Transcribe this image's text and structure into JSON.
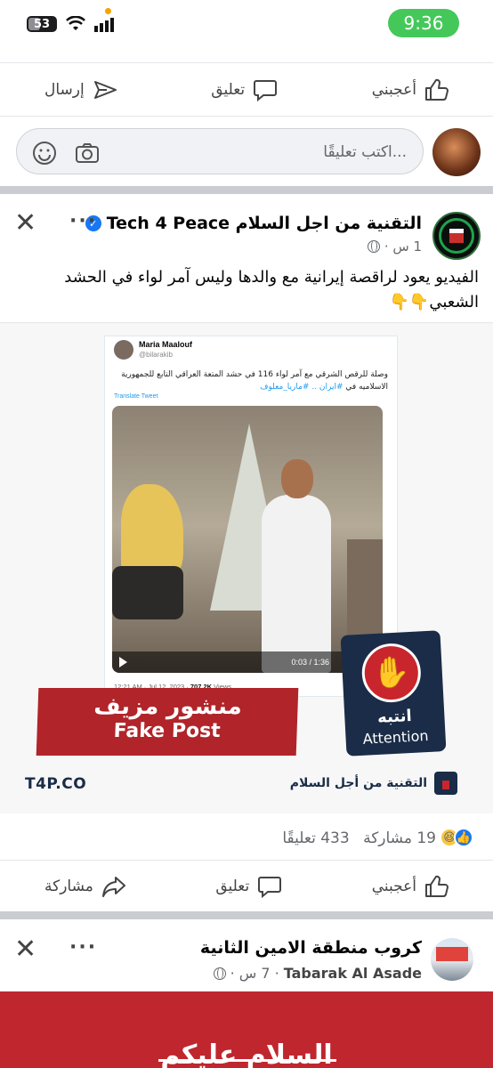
{
  "status_bar": {
    "battery": "53",
    "time": "9:36"
  },
  "top_actions": {
    "like": "أعجبني",
    "comment": "تعليق",
    "send": "إرسال"
  },
  "comment_box": {
    "placeholder": "اكتب تعليقًا..."
  },
  "post": {
    "page_name": "التقنية من اجل السلام Tech 4 Peace",
    "time": "1 س ·",
    "text": "الفيديو يعود لراقصة إيرانية مع والدها وليس آمر لواء في الحشد الشعبي👇👇",
    "image": {
      "tweet_author": "Maria Maalouf",
      "tweet_handle": "@bilarakib",
      "tweet_text": "وصلة للرقص الشرقي مع آمر لواء 116 في حشد المتعة العراقي التابع للجمهورية الاسلاميه في",
      "tweet_hashtags": "#ايران .. #ماريا_معلوف",
      "translate": "Translate Tweet",
      "video_time": "0:03 / 1:36",
      "tweet_date": "12:21 AM · Jul 12, 2023 · ",
      "tweet_views": "707.2K",
      "tweet_views_label": " Views",
      "fake_ar": "منشور مزيف",
      "fake_en": "Fake Post",
      "attention_ar": "انتبه",
      "attention_en": "Attention",
      "site": "T4P.CO",
      "brand": "التقنية من أجل السلام"
    },
    "comments_count": "433 تعليقًا",
    "shares_count": "19 مشاركة"
  },
  "post_actions": {
    "like": "أعجبني",
    "comment": "تعليق",
    "share": "مشاركة"
  },
  "next_post": {
    "group_name": "كروب منطقة الامين الثانية",
    "author": "Tabarak Al Asade",
    "time": "· 7 س ·",
    "banner_text": "السلام عليكم"
  },
  "colors": {
    "accent": "#1877f2",
    "fake_red": "#b1242a",
    "brand_navy": "#1a2c47",
    "time_green": "#45c85a"
  }
}
